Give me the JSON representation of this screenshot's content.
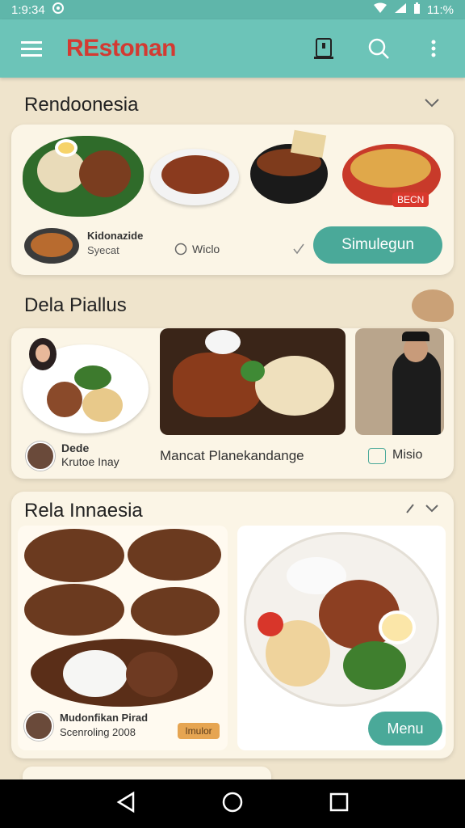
{
  "status_bar": {
    "time": "1:9:34",
    "right_text": "11:%"
  },
  "app_bar": {
    "title": "REstonan"
  },
  "section1": {
    "title": "Rendoonesia",
    "caption_title": "Kidonazide",
    "caption_sub": "Syecat",
    "check_label": "Wiclo",
    "badge": "BECN",
    "button": "Simulegun"
  },
  "section2": {
    "title": "Dela Piallus",
    "profile_name": "Dede",
    "profile_sub": "Krutoe Inay",
    "dish_caption": "Mancat Planekandange",
    "side_label": "Misio"
  },
  "section3": {
    "title": "Rela Innaesia",
    "profile_name": "Mudonfikan Pirad",
    "profile_sub": "Scenroling 2008",
    "tag": "Imulor",
    "button": "Menu"
  }
}
